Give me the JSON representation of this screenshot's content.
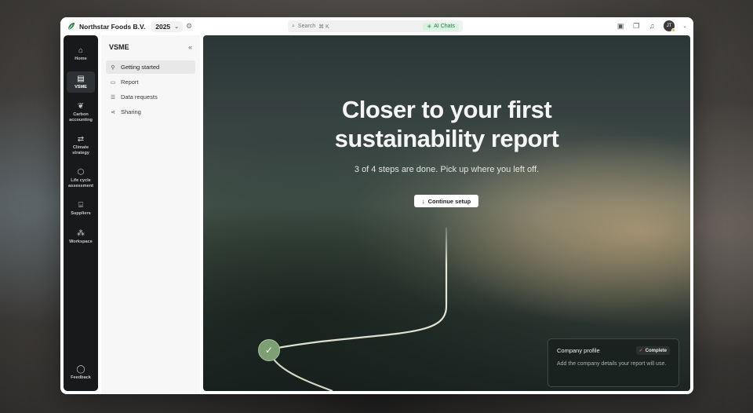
{
  "app": {
    "org_name": "Northstar Foods B.V.",
    "year": "2025",
    "search_placeholder": "Search",
    "search_shortcut": "⌘ K",
    "ai_chat_label": "AI Chats",
    "avatar_initials": "JT"
  },
  "rail": {
    "items": [
      {
        "label": "Home",
        "icon": "home-icon"
      },
      {
        "label": "VSME",
        "icon": "report-icon"
      },
      {
        "label": "Carbon accounting",
        "icon": "leaf-icon"
      },
      {
        "label": "Climate strategy",
        "icon": "route-icon"
      },
      {
        "label": "Life cycle assessment",
        "icon": "box-icon"
      },
      {
        "label": "Suppliers",
        "icon": "store-icon"
      },
      {
        "label": "Workspace",
        "icon": "workspace-icon"
      }
    ],
    "feedback_label": "Feedback"
  },
  "sidenav": {
    "title": "VSME",
    "items": [
      {
        "label": "Getting started",
        "icon": "link-icon"
      },
      {
        "label": "Report",
        "icon": "document-icon"
      },
      {
        "label": "Data requests",
        "icon": "list-icon"
      },
      {
        "label": "Sharing",
        "icon": "share-icon"
      }
    ]
  },
  "hero": {
    "title_line1": "Closer to your first",
    "title_line2": "sustainability report",
    "subtitle": "3 of 4 steps are done. Pick up where you left off.",
    "cta_label": "Continue setup"
  },
  "card": {
    "title": "Company profile",
    "status": "Complete",
    "description": "Add the company details your report will use."
  },
  "colors": {
    "rail_bg": "#17191b",
    "accent_green": "#7c9f73",
    "ai_chip_bg": "#d8f3df"
  }
}
